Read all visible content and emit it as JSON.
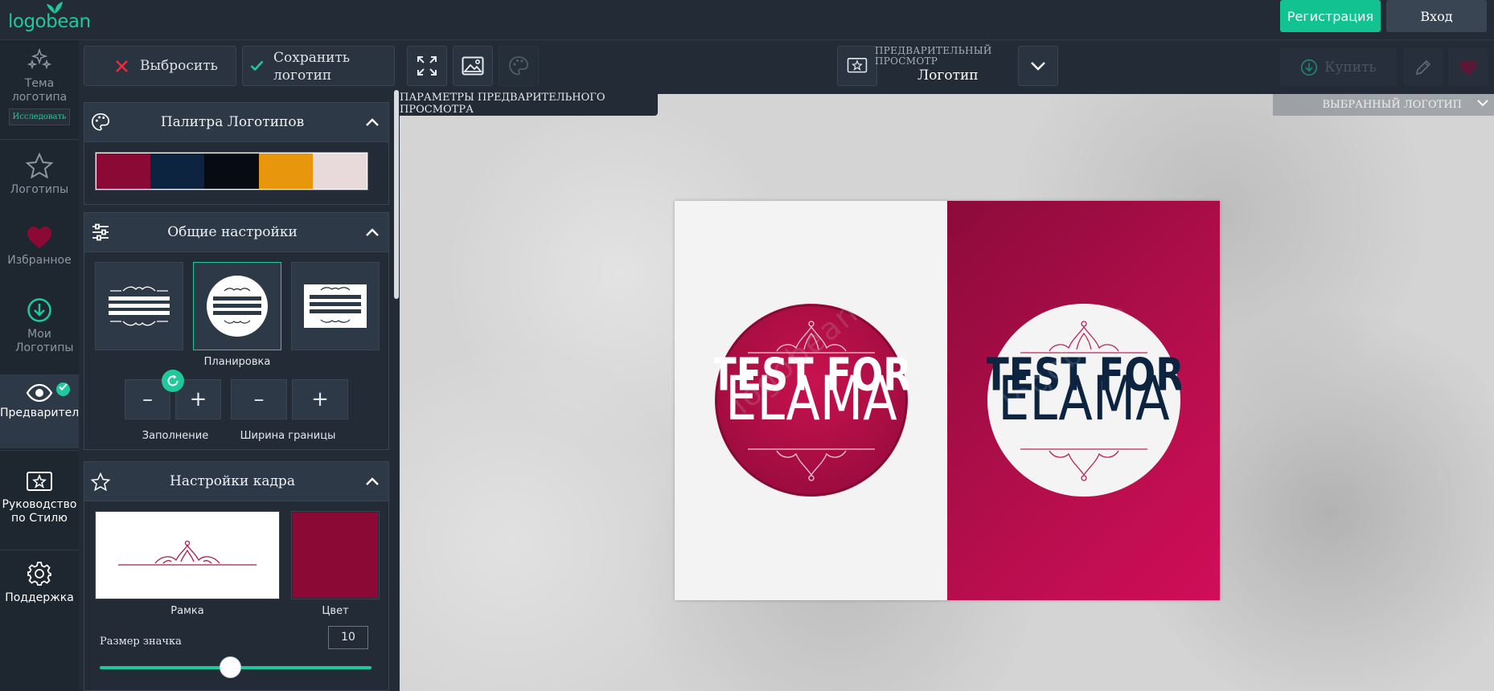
{
  "app": {
    "brand": "logobean"
  },
  "header": {
    "register_label": "Регистрация",
    "login_label": "Вход"
  },
  "leftnav": {
    "items": [
      {
        "label": "Тема логотипа",
        "badge": "Исследовать",
        "icon": "sparkles-icon"
      },
      {
        "label": "Логотипы",
        "icon": "star-icon"
      },
      {
        "label": "Избранное",
        "icon": "heart-icon"
      },
      {
        "label": "Мои Логотипы",
        "icon": "download-circle-icon"
      },
      {
        "label": "Предварительные просмотры",
        "icon": "eye-icon"
      },
      {
        "label": "Руководство по Стилю",
        "icon": "style-guide-icon"
      },
      {
        "label": "Поддержка",
        "icon": "gear-icon"
      }
    ]
  },
  "toolbar": {
    "discard_label": "Выбросить",
    "save_label_line1": "Сохранить",
    "save_label_line2": "логотип",
    "preview_caption_line1": "ПРЕДВАРИТЕЛЬНЫЙ",
    "preview_caption_line2": "ПРОСМОТР",
    "preview_value": "Логотип",
    "buy_label": "Купить"
  },
  "panel": {
    "palette": {
      "title": "Палитра Логотипов",
      "colors": [
        "#8a0a35",
        "#0c2440",
        "#060b14",
        "#e8960b",
        "#e8dada"
      ]
    },
    "general": {
      "title": "Общие настройки",
      "layout_label": "Планировка",
      "fill_label": "Заполнение",
      "border_width_label": "Ширина границы",
      "minus": "–",
      "plus": "+"
    },
    "frame": {
      "title": "Настройки кадра",
      "frame_label": "Рамка",
      "color_label": "Цвет",
      "color_value": "#8a0a35",
      "icon_size_label": "Размер значка",
      "icon_size_value": "10",
      "icon_size_fraction": 0.48
    }
  },
  "canvas": {
    "preview_params_tab": "ПАРАМЕТРЫ ПРЕДВАРИТЕЛЬНОГО ПРОСМОТРА",
    "selected_logo_tab": "ВЫБРАННЫЙ ЛОГОТИП",
    "logo": {
      "line1": "TEST FOR",
      "line2": "ELAMA",
      "watermark": "logobean",
      "accent": "#b30e4b",
      "navy": "#0c2440"
    }
  }
}
